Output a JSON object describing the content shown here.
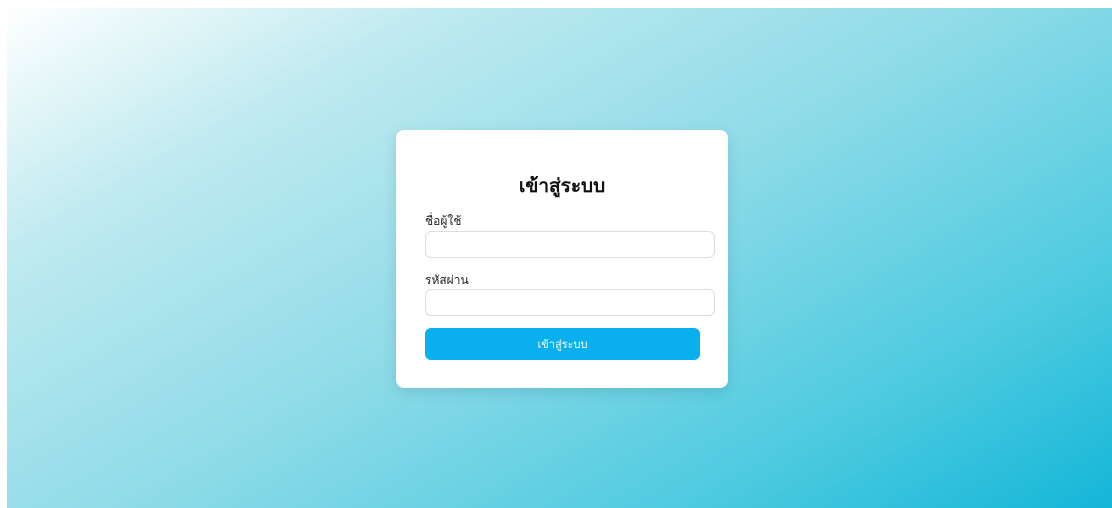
{
  "login": {
    "title": "เข้าสู่ระบบ",
    "username_label": "ชื่อผู้ใช้",
    "username_value": "",
    "password_label": "รหัสผ่าน",
    "password_value": "",
    "submit_label": "เข้าสู่ระบบ"
  },
  "colors": {
    "button": "#0ab0ee",
    "gradient_start": "#ffffff",
    "gradient_end": "#14b6d8"
  }
}
